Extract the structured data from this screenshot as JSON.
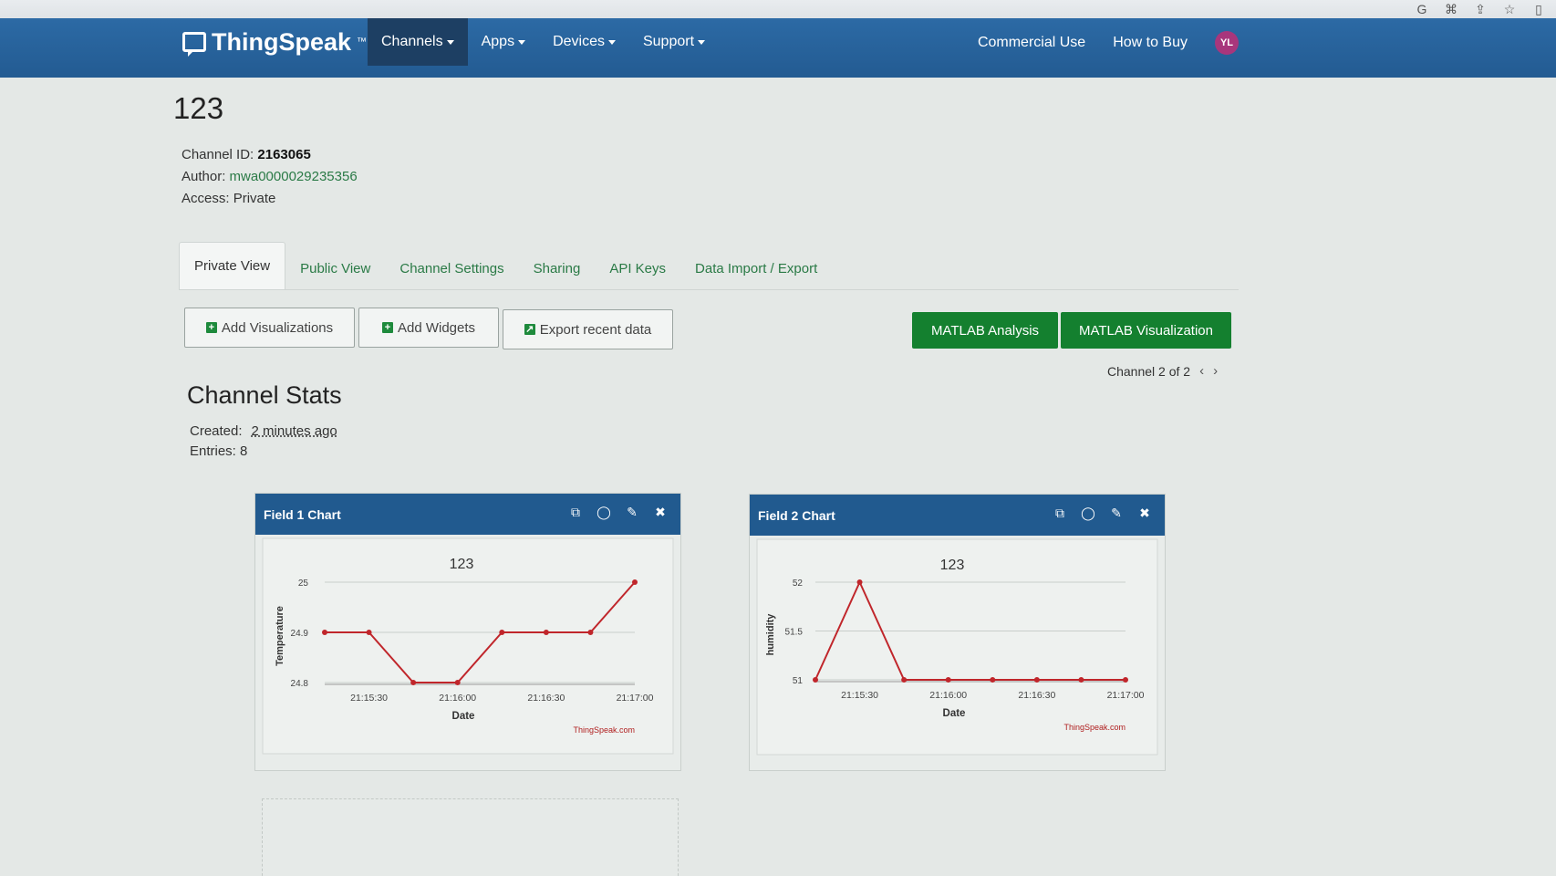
{
  "nav": {
    "brand": "ThingSpeak",
    "trademark": "™",
    "menu": [
      {
        "label": "Channels",
        "active": true
      },
      {
        "label": "Apps",
        "active": false
      },
      {
        "label": "Devices",
        "active": false
      },
      {
        "label": "Support",
        "active": false
      }
    ],
    "commercial": "Commercial Use",
    "how_to_buy": "How to Buy",
    "avatar": "YL"
  },
  "channel": {
    "name": "123",
    "id_label": "Channel ID:",
    "id": "2163065",
    "author_label": "Author:",
    "author": "mwa0000029235356",
    "access_label": "Access:",
    "access": "Private"
  },
  "tabs": [
    "Private View",
    "Public View",
    "Channel Settings",
    "Sharing",
    "API Keys",
    "Data Import / Export"
  ],
  "actions": {
    "add_visualizations": "Add Visualizations",
    "add_widgets": "Add Widgets",
    "export": "Export recent data",
    "matlab_analysis": "MATLAB Analysis",
    "matlab_visualization": "MATLAB Visualization"
  },
  "pager": "Channel 2 of 2",
  "stats": {
    "title": "Channel Stats",
    "created_label": "Created:",
    "created": "2 minutes ago",
    "entries_label": "Entries:",
    "entries": "8"
  },
  "colors": {
    "navbar": "#2c6aa5",
    "card_header": "#215a8f",
    "green_button": "#14802f",
    "link": "#2a7a46",
    "series": "#c0262b"
  },
  "chart_data": [
    {
      "type": "line",
      "header": "Field 1 Chart",
      "title": "123",
      "xlabel": "Date",
      "ylabel": "Temperature",
      "credit": "ThingSpeak.com",
      "x": [
        "21:15:15",
        "21:15:30",
        "21:15:45",
        "21:16:00",
        "21:16:15",
        "21:16:30",
        "21:16:45",
        "21:17:00"
      ],
      "values": [
        24.9,
        24.9,
        24.8,
        24.8,
        24.9,
        24.9,
        24.9,
        25.0
      ],
      "ylim": [
        24.8,
        25.0
      ],
      "yticks": [
        "24.8",
        "24.9",
        "25"
      ],
      "xticks": [
        "21:15:30",
        "21:16:00",
        "21:16:30",
        "21:17:00"
      ]
    },
    {
      "type": "line",
      "header": "Field 2 Chart",
      "title": "123",
      "xlabel": "Date",
      "ylabel": "humidity",
      "credit": "ThingSpeak.com",
      "x": [
        "21:15:15",
        "21:15:30",
        "21:15:45",
        "21:16:00",
        "21:16:15",
        "21:16:30",
        "21:16:45",
        "21:17:00"
      ],
      "values": [
        51,
        52,
        51,
        51,
        51,
        51,
        51,
        51
      ],
      "ylim": [
        51,
        52
      ],
      "yticks": [
        "51",
        "51.5",
        "52"
      ],
      "xticks": [
        "21:15:30",
        "21:16:00",
        "21:16:30",
        "21:17:00"
      ]
    }
  ]
}
